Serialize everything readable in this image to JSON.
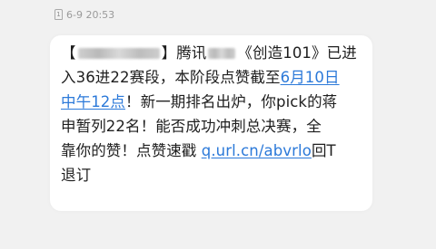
{
  "timestamp": {
    "sim_icon": "1",
    "text": "6-9 20:53"
  },
  "message": {
    "line1": {
      "bracket_open": "【",
      "after_redact": "】腾讯",
      "rest": "《创造101》已进"
    },
    "line2": {
      "text": "入36进22赛段，本阶段点赞截至",
      "link": "6月10日"
    },
    "line3": {
      "link": "中午12点",
      "text": "！新一期排名出炉，你pick的蒋"
    },
    "line4": {
      "text": "申暂列22名！能否成功冲刺总决赛，全"
    },
    "line5": {
      "text": "靠你的赞！点赞速戳 ",
      "url": "q.url.cn/abvrlo",
      "after_url": "回T"
    },
    "line6": {
      "text": "退订"
    }
  },
  "colors": {
    "background": "#f1f1f1",
    "bubble": "#ffffff",
    "link": "#2b79d9",
    "text": "#1e1e1e",
    "meta": "#9a9a9a"
  }
}
